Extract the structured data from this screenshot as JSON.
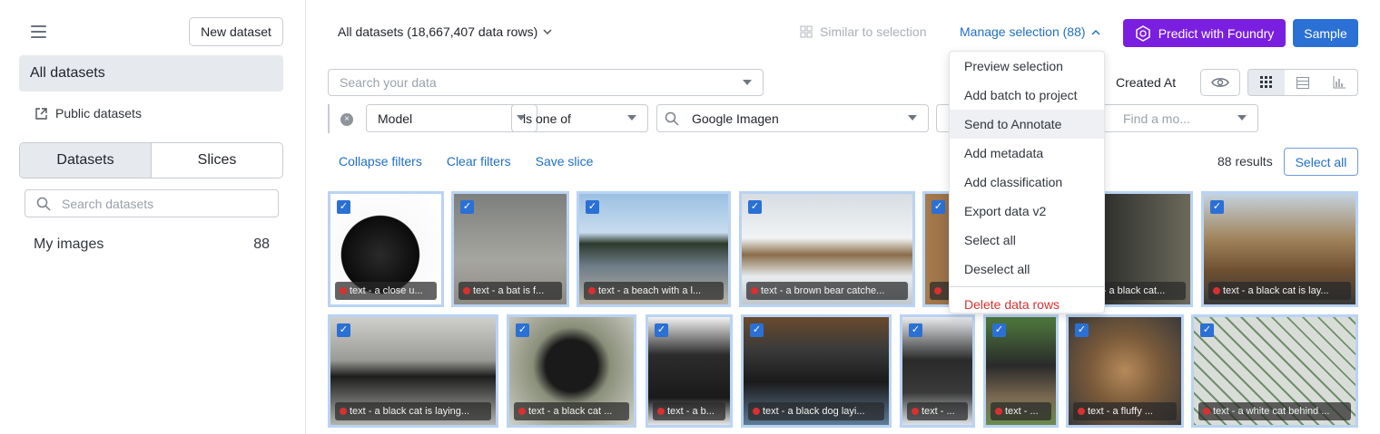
{
  "sidebar": {
    "new_dataset": "New dataset",
    "all_datasets": "All datasets",
    "public_datasets": "Public datasets",
    "tabs": [
      "Datasets",
      "Slices"
    ],
    "search_placeholder": "Search datasets",
    "my_images": {
      "label": "My images",
      "count": "88"
    }
  },
  "header": {
    "title": "All datasets (18,667,407 data rows)",
    "similar": "Similar to selection",
    "manage": "Manage selection (88)",
    "predict": "Predict with Foundry",
    "sample": "Sample"
  },
  "toolbar": {
    "search_placeholder": "Search your data",
    "sort": "Created At"
  },
  "filter": {
    "field": "Model",
    "operator": "is one of",
    "value": "Google Imagen",
    "model_placeholder": "Find a mo..."
  },
  "filter_links": [
    "Collapse filters",
    "Clear filters",
    "Save slice"
  ],
  "results": "88 results",
  "select_all": "Select all",
  "menu": {
    "items": [
      "Preview selection",
      "Add batch to project",
      "Send to Annotate",
      "Add metadata",
      "Add classification",
      "Export data v2",
      "Select all",
      "Deselect all"
    ],
    "danger": "Delete data rows"
  },
  "thumbs": [
    {
      "caption": "text - a close u..."
    },
    {
      "caption": "text - a bat is f..."
    },
    {
      "caption": "text - a beach with a l..."
    },
    {
      "caption": "text - a brown bear catche..."
    },
    {
      "caption": "text - a black cat..."
    },
    {
      "caption": "text - a black cat is lay..."
    },
    {
      "caption": "text - a black cat is laying..."
    },
    {
      "caption": "text - a black cat ..."
    },
    {
      "caption": "text - a b..."
    },
    {
      "caption": "text - a black dog layi..."
    },
    {
      "caption": "text - ..."
    },
    {
      "caption": "text - ..."
    },
    {
      "caption": "text - a fluffy ..."
    },
    {
      "caption": "text - a white cat behind ..."
    }
  ],
  "colors": {
    "accent": "#2b70d4",
    "foundry": "#7a1fe0",
    "danger": "#d93030"
  }
}
